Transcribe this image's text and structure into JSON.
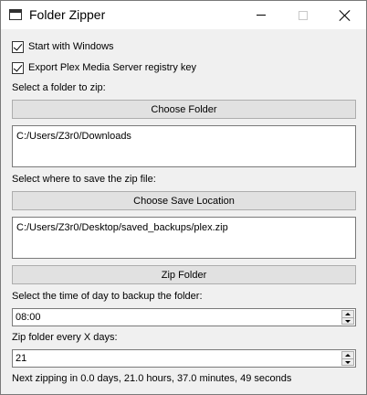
{
  "window": {
    "title": "Folder Zipper",
    "app_icon": "window-icon",
    "controls": {
      "minimize_icon": "minimize-icon",
      "maximize_icon": "maximize-icon",
      "close_icon": "close-icon"
    }
  },
  "options": {
    "start_with_windows": {
      "label": "Start with Windows",
      "checked": true
    },
    "export_registry": {
      "label": "Export Plex Media Server registry key",
      "checked": true
    }
  },
  "source": {
    "label": "Select a folder to zip:",
    "button_label": "Choose Folder",
    "path": "C:/Users/Z3r0/Downloads"
  },
  "destination": {
    "label": "Select where to save the zip file:",
    "button_label": "Choose Save Location",
    "path": "C:/Users/Z3r0/Desktop/saved_backups/plex.zip"
  },
  "actions": {
    "zip_button_label": "Zip Folder"
  },
  "schedule": {
    "time_label": "Select the time of day to backup the folder:",
    "time_value": "08:00",
    "interval_label": "Zip folder every X days:",
    "interval_value": "21",
    "next_run_text": "Next zipping in 0.0 days, 21.0 hours, 37.0 minutes, 49 seconds"
  }
}
